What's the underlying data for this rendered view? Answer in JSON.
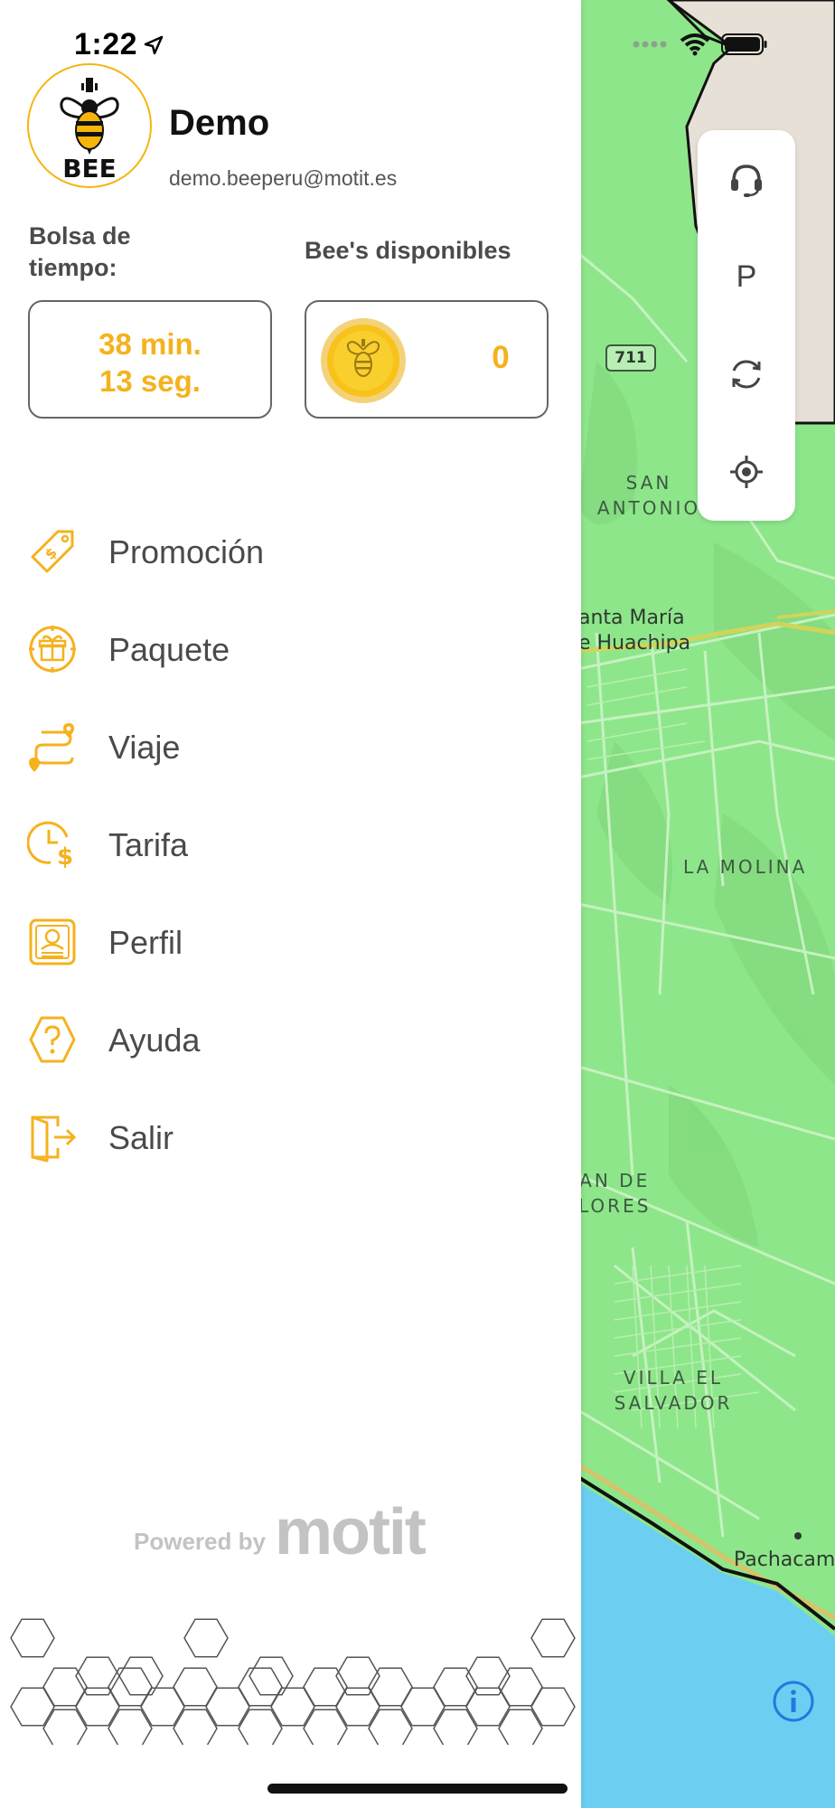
{
  "status_bar": {
    "time": "1:22",
    "location_icon": "location-arrow-icon",
    "signal_icon": "signal-dots-icon",
    "wifi_icon": "wifi-icon",
    "battery_icon": "battery-icon"
  },
  "user": {
    "logo_text": "BEE",
    "name": "Demo",
    "email": "demo.beeperu@motit.es"
  },
  "balances": {
    "time_label": "Bolsa de tiempo:",
    "time_line1": "38 min.",
    "time_line2": "13 seg.",
    "bees_label": "Bee's disponibles",
    "bees_count": "0",
    "coin_icon": "bee-coin-icon"
  },
  "menu": [
    {
      "label": "Promoción",
      "icon": "price-tag-icon"
    },
    {
      "label": "Paquete",
      "icon": "gift-icon"
    },
    {
      "label": "Viaje",
      "icon": "route-icon"
    },
    {
      "label": "Tarifa",
      "icon": "clock-dollar-icon"
    },
    {
      "label": "Perfil",
      "icon": "profile-card-icon"
    },
    {
      "label": "Ayuda",
      "icon": "help-icon"
    },
    {
      "label": "Salir",
      "icon": "exit-door-icon"
    }
  ],
  "footer": {
    "powered_by": "Powered by",
    "brand": "motit"
  },
  "map": {
    "road_badge": "711",
    "labels": {
      "san_antonio_1": "SAN",
      "san_antonio_2": "ANTONIO",
      "santa_maria_1": "anta María",
      "santa_maria_2": "e Huachipa",
      "la_molina": "LA MOLINA",
      "san_de_1": "AN DE",
      "san_de_2": "LORES",
      "villa_1": "VILLA EL",
      "villa_2": "SALVADOR",
      "pachacamac": "Pachacam"
    },
    "tools": [
      {
        "name": "support",
        "icon": "headset-icon"
      },
      {
        "name": "parking",
        "text": "P"
      },
      {
        "name": "refresh",
        "icon": "refresh-icon"
      },
      {
        "name": "locate",
        "icon": "crosshair-icon"
      }
    ],
    "info_icon": "info-icon",
    "colors": {
      "land": "#8ee68b",
      "sea": "#6ccff2",
      "road": "#c6f2c0",
      "outside": "#e6e0d6"
    }
  },
  "colors": {
    "accent": "#f5b21d",
    "text": "#4a4a4a",
    "border": "#666666"
  }
}
